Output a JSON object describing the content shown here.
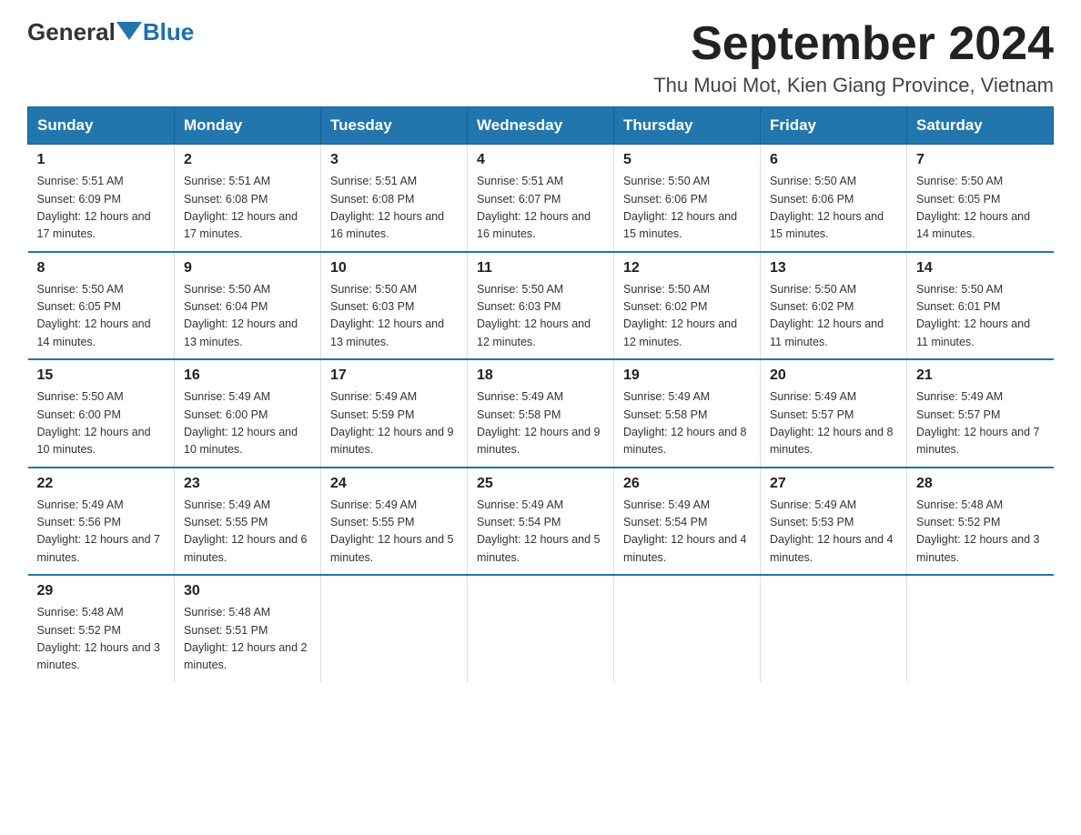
{
  "header": {
    "logo": {
      "general": "General",
      "blue": "Blue"
    },
    "title": "September 2024",
    "location": "Thu Muoi Mot, Kien Giang Province, Vietnam"
  },
  "columns": [
    "Sunday",
    "Monday",
    "Tuesday",
    "Wednesday",
    "Thursday",
    "Friday",
    "Saturday"
  ],
  "weeks": [
    [
      {
        "day": "1",
        "sunrise": "5:51 AM",
        "sunset": "6:09 PM",
        "daylight": "12 hours and 17 minutes."
      },
      {
        "day": "2",
        "sunrise": "5:51 AM",
        "sunset": "6:08 PM",
        "daylight": "12 hours and 17 minutes."
      },
      {
        "day": "3",
        "sunrise": "5:51 AM",
        "sunset": "6:08 PM",
        "daylight": "12 hours and 16 minutes."
      },
      {
        "day": "4",
        "sunrise": "5:51 AM",
        "sunset": "6:07 PM",
        "daylight": "12 hours and 16 minutes."
      },
      {
        "day": "5",
        "sunrise": "5:50 AM",
        "sunset": "6:06 PM",
        "daylight": "12 hours and 15 minutes."
      },
      {
        "day": "6",
        "sunrise": "5:50 AM",
        "sunset": "6:06 PM",
        "daylight": "12 hours and 15 minutes."
      },
      {
        "day": "7",
        "sunrise": "5:50 AM",
        "sunset": "6:05 PM",
        "daylight": "12 hours and 14 minutes."
      }
    ],
    [
      {
        "day": "8",
        "sunrise": "5:50 AM",
        "sunset": "6:05 PM",
        "daylight": "12 hours and 14 minutes."
      },
      {
        "day": "9",
        "sunrise": "5:50 AM",
        "sunset": "6:04 PM",
        "daylight": "12 hours and 13 minutes."
      },
      {
        "day": "10",
        "sunrise": "5:50 AM",
        "sunset": "6:03 PM",
        "daylight": "12 hours and 13 minutes."
      },
      {
        "day": "11",
        "sunrise": "5:50 AM",
        "sunset": "6:03 PM",
        "daylight": "12 hours and 12 minutes."
      },
      {
        "day": "12",
        "sunrise": "5:50 AM",
        "sunset": "6:02 PM",
        "daylight": "12 hours and 12 minutes."
      },
      {
        "day": "13",
        "sunrise": "5:50 AM",
        "sunset": "6:02 PM",
        "daylight": "12 hours and 11 minutes."
      },
      {
        "day": "14",
        "sunrise": "5:50 AM",
        "sunset": "6:01 PM",
        "daylight": "12 hours and 11 minutes."
      }
    ],
    [
      {
        "day": "15",
        "sunrise": "5:50 AM",
        "sunset": "6:00 PM",
        "daylight": "12 hours and 10 minutes."
      },
      {
        "day": "16",
        "sunrise": "5:49 AM",
        "sunset": "6:00 PM",
        "daylight": "12 hours and 10 minutes."
      },
      {
        "day": "17",
        "sunrise": "5:49 AM",
        "sunset": "5:59 PM",
        "daylight": "12 hours and 9 minutes."
      },
      {
        "day": "18",
        "sunrise": "5:49 AM",
        "sunset": "5:58 PM",
        "daylight": "12 hours and 9 minutes."
      },
      {
        "day": "19",
        "sunrise": "5:49 AM",
        "sunset": "5:58 PM",
        "daylight": "12 hours and 8 minutes."
      },
      {
        "day": "20",
        "sunrise": "5:49 AM",
        "sunset": "5:57 PM",
        "daylight": "12 hours and 8 minutes."
      },
      {
        "day": "21",
        "sunrise": "5:49 AM",
        "sunset": "5:57 PM",
        "daylight": "12 hours and 7 minutes."
      }
    ],
    [
      {
        "day": "22",
        "sunrise": "5:49 AM",
        "sunset": "5:56 PM",
        "daylight": "12 hours and 7 minutes."
      },
      {
        "day": "23",
        "sunrise": "5:49 AM",
        "sunset": "5:55 PM",
        "daylight": "12 hours and 6 minutes."
      },
      {
        "day": "24",
        "sunrise": "5:49 AM",
        "sunset": "5:55 PM",
        "daylight": "12 hours and 5 minutes."
      },
      {
        "day": "25",
        "sunrise": "5:49 AM",
        "sunset": "5:54 PM",
        "daylight": "12 hours and 5 minutes."
      },
      {
        "day": "26",
        "sunrise": "5:49 AM",
        "sunset": "5:54 PM",
        "daylight": "12 hours and 4 minutes."
      },
      {
        "day": "27",
        "sunrise": "5:49 AM",
        "sunset": "5:53 PM",
        "daylight": "12 hours and 4 minutes."
      },
      {
        "day": "28",
        "sunrise": "5:48 AM",
        "sunset": "5:52 PM",
        "daylight": "12 hours and 3 minutes."
      }
    ],
    [
      {
        "day": "29",
        "sunrise": "5:48 AM",
        "sunset": "5:52 PM",
        "daylight": "12 hours and 3 minutes."
      },
      {
        "day": "30",
        "sunrise": "5:48 AM",
        "sunset": "5:51 PM",
        "daylight": "12 hours and 2 minutes."
      },
      null,
      null,
      null,
      null,
      null
    ]
  ]
}
